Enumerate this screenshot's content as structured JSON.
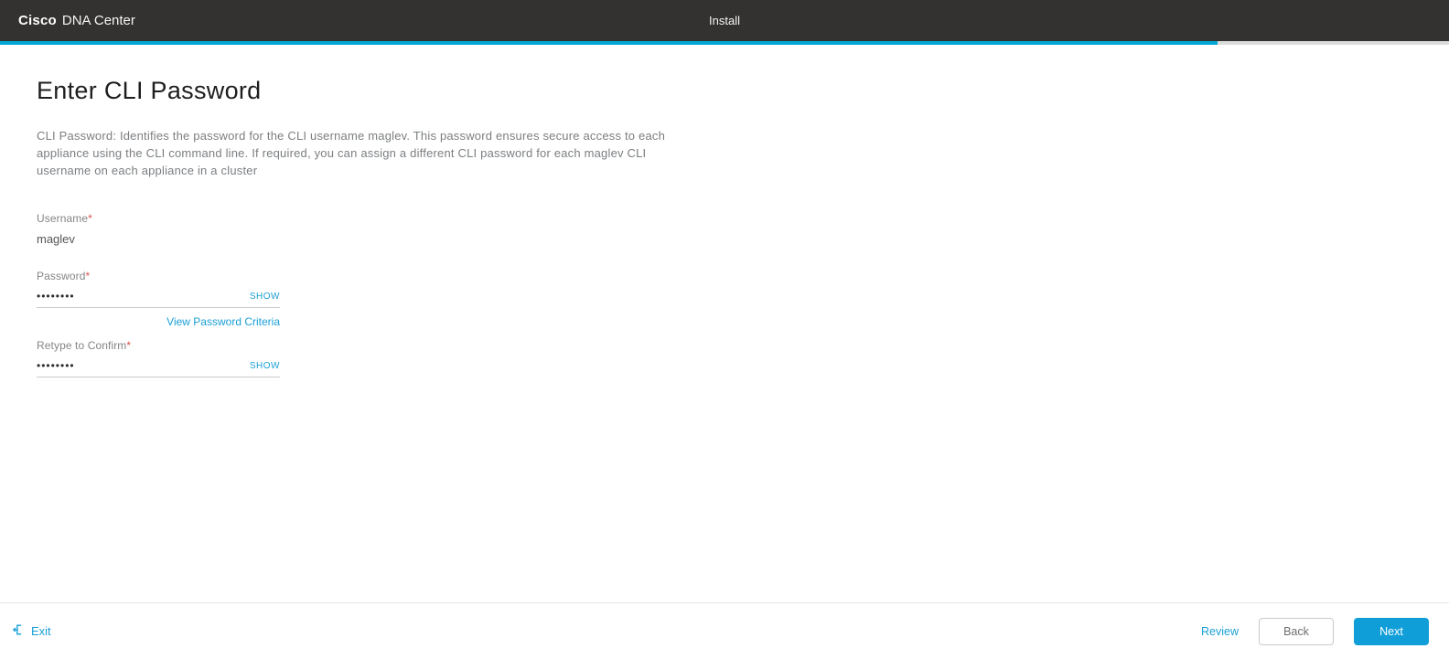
{
  "header": {
    "brand_bold": "Cisco",
    "brand_rest": "DNA Center",
    "center": "Install"
  },
  "progress": {
    "percent": 84
  },
  "page": {
    "title": "Enter CLI Password",
    "description": "CLI Password: Identifies the password for the CLI username maglev. This password ensures secure access to each appliance using the CLI command line. If required, you can assign a different CLI password for each maglev CLI username on each appliance in a cluster"
  },
  "form": {
    "username_label": "Username",
    "username_value": "maglev",
    "password_label": "Password",
    "password_value": "••••••••",
    "show_label_password": "SHOW",
    "criteria_link": "View Password Criteria",
    "retype_label": "Retype to Confirm",
    "retype_value": "••••••••",
    "show_label_retype": "SHOW"
  },
  "footer": {
    "exit": "Exit",
    "review": "Review",
    "back": "Back",
    "next": "Next"
  }
}
